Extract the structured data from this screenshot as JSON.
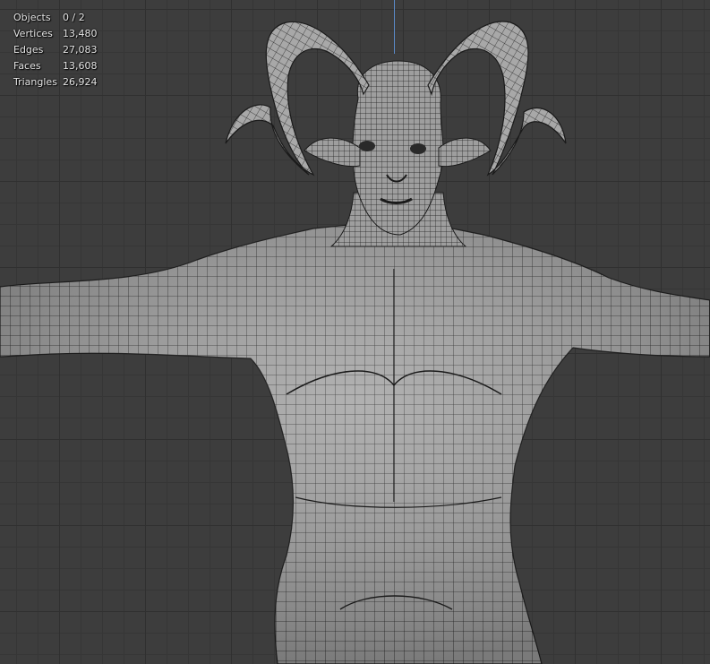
{
  "viewport": {
    "name": "3D Viewport",
    "background": "#3d3d3d",
    "grid_color": "#303030",
    "z_axis_color": "#5a8ac8",
    "mesh_color": "#9b9b9b",
    "wire_color": "#1a1a1a"
  },
  "stats": [
    {
      "label": "Objects",
      "value": "0 / 2"
    },
    {
      "label": "Vertices",
      "value": "13,480"
    },
    {
      "label": "Edges",
      "value": "27,083"
    },
    {
      "label": "Faces",
      "value": "13,608"
    },
    {
      "label": "Triangles",
      "value": "26,924"
    }
  ]
}
